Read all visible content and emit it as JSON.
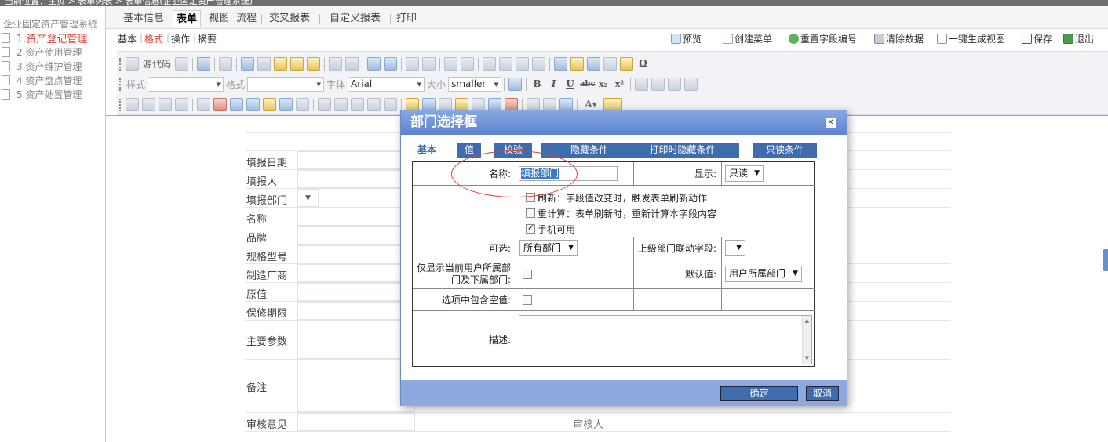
{
  "topbar": {
    "text": "当前位置：主页 > 表单列表 > 表单信息(企业固定资产管理系统)"
  },
  "sidebar": {
    "title": "企业固定资产管理系统",
    "items": [
      {
        "label": "1.资产登记管理",
        "active": true
      },
      {
        "label": "2.资产使用管理"
      },
      {
        "label": "3.资产维护管理"
      },
      {
        "label": "4.资产盘点管理"
      },
      {
        "label": "5.资产处置管理"
      }
    ]
  },
  "tabs": [
    "基本信息",
    "表单",
    "视图",
    "流程",
    "交叉报表",
    "自定义报表",
    "打印"
  ],
  "subtabs": [
    "基本",
    "格式",
    "操作",
    "摘要"
  ],
  "actions": [
    "预览",
    "创建菜单",
    "重置字段编号",
    "清除数据",
    "一键生成视图",
    "保存",
    "退出"
  ],
  "editor": {
    "source_label": "源代码",
    "style_label": "样式",
    "format_label": "格式",
    "font_label": "字体",
    "font_value": "Arial",
    "size_label": "大小",
    "size_value": "smaller"
  },
  "form_rows": [
    "填报日期",
    "填报人",
    "填报部门",
    "名称",
    "品牌",
    "规格型号",
    "制造厂商",
    "原值",
    "保修期限",
    "主要参数",
    "备注",
    "审核意见"
  ],
  "form_right_label": "审核人",
  "dialog": {
    "title": "部门选择框",
    "tabs": [
      "基本",
      "值",
      "校验",
      "隐藏条件",
      "打印时隐藏条件",
      "只读条件"
    ],
    "name_label": "名称:",
    "name_value": "填报部门",
    "display_label": "显示:",
    "display_value": "只读",
    "options": [
      {
        "label": "刷新：字段值改变时，触发表单刷新动作",
        "checked": false
      },
      {
        "label": "重计算：表单刷新时，重新计算本字段内容",
        "checked": false
      },
      {
        "label": "手机可用",
        "checked": true
      }
    ],
    "optional_label": "可选:",
    "optional_value": "所有部门",
    "parent_label": "上级部门联动字段:",
    "parent_value": "",
    "only_current_label": "仅显示当前用户所属部门及下属部门:",
    "default_label": "默认值:",
    "default_value": "用户所属部门",
    "include_empty_label": "选项中包含空值:",
    "desc_label": "描述:",
    "ok": "确定",
    "cancel": "取消"
  }
}
